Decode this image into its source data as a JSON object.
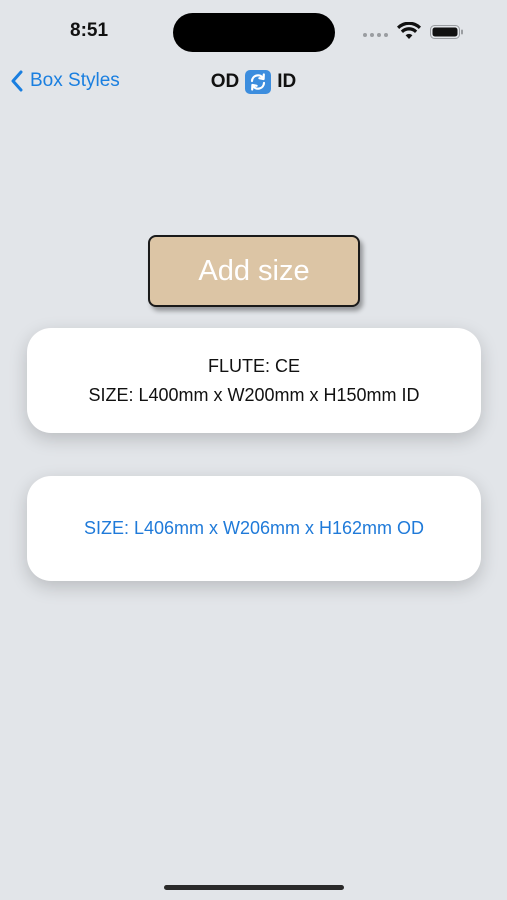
{
  "status_bar": {
    "time": "8:51",
    "icons": [
      "signal-dots-icon",
      "wifi-icon",
      "battery-icon"
    ]
  },
  "nav": {
    "back_label": "Box Styles",
    "title_left": "OD",
    "title_icon": "swap-arrows-icon",
    "title_right": "ID"
  },
  "add_button": {
    "label": "Add size"
  },
  "id_card": {
    "flute": "FLUTE: CE",
    "size": "SIZE: L400mm x W200mm x H150mm ID"
  },
  "od_card": {
    "size": "SIZE: L406mm x W206mm x H162mm OD"
  },
  "colors": {
    "background": "#e2e5e9",
    "accent": "#1a7fe0",
    "button_fill": "#dcc5a5",
    "card_fill": "#ffffff"
  }
}
